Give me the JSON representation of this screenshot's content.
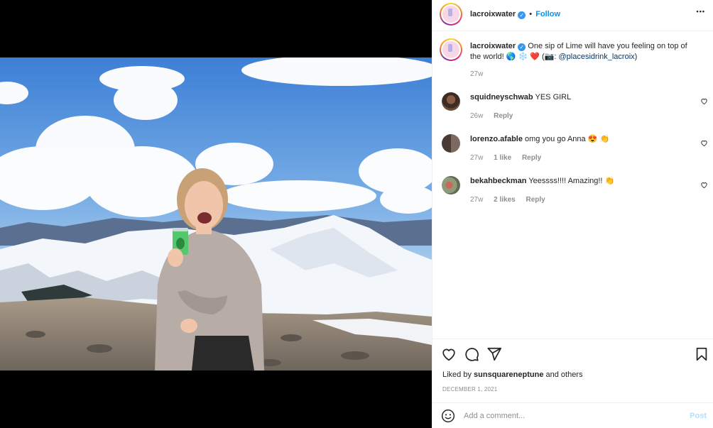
{
  "post": {
    "username": "lacroixwater",
    "follow_separator": "•",
    "follow_label": "Follow",
    "more_label": "•••"
  },
  "caption": {
    "username": "lacroixwater",
    "text": "One sip of Lime will have you feeling on top of the world! 🌎 ❄️ ❤️ (📷: ",
    "mention": "@placesidrink_lacroix",
    "text_end": ")",
    "age": "27w"
  },
  "comments": [
    {
      "username": "squidneyschwab",
      "text": "YES GIRL",
      "age": "26w",
      "likes": "",
      "reply_label": "Reply"
    },
    {
      "username": "lorenzo.afable",
      "text": "omg you go Anna 😍 👏",
      "age": "27w",
      "likes": "1 like",
      "reply_label": "Reply"
    },
    {
      "username": "bekahbeckman",
      "text": "Yeessss!!!! Amazing!! 👏",
      "age": "27w",
      "likes": "2 likes",
      "reply_label": "Reply"
    }
  ],
  "liked_by": {
    "prefix": "Liked by ",
    "user": "sunsquareneptune",
    "suffix": " and others"
  },
  "date": "DECEMBER 1, 2021",
  "add_comment": {
    "placeholder": "Add a comment...",
    "post_label": "Post"
  },
  "colors": {
    "accent": "#0095f6",
    "post_disabled": "#b2dffc",
    "muted": "#8e8e8e",
    "text": "#262626"
  }
}
